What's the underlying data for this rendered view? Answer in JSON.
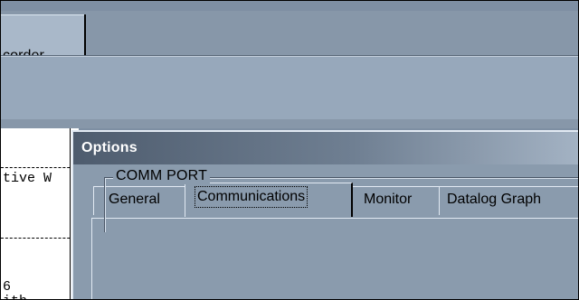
{
  "recorder_tab": {
    "label": "corder"
  },
  "text_panel": {
    "lines": [
      "tive W",
      "6",
      "ith"
    ]
  },
  "dialog": {
    "title": "Options",
    "tabs": [
      {
        "label": "General"
      },
      {
        "label": "Communications"
      },
      {
        "label": "Monitor"
      },
      {
        "label": "Datalog Graph"
      }
    ],
    "group_title": "COMM PORT"
  }
}
